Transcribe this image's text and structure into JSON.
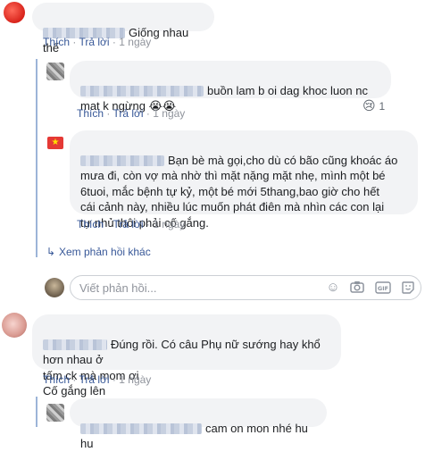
{
  "actions": {
    "like": "Thích",
    "reply": "Trả lời",
    "sep": "·",
    "time": "1 ngày"
  },
  "comments": [
    {
      "text": "Giống nhau thế"
    },
    {
      "text": "buồn lam b oi dag khoc luon nc\nmat k ngừng 😭😭",
      "reaction": "😢",
      "reaction_count": "1"
    },
    {
      "text": "Bạn bè mà gọi,cho dù có bão cũng khoác áo\nmưa đi, còn vợ mà nhờ thì mặt nặng mặt nhẹ, mình một bé\n6tuoi, mắc bệnh tự kỷ, một bé mới 5thang,bao giờ cho hết\ncái cảnh này, nhiều lúc muốn phát điên mà nhìn các con lại\ntự nhủ thôi phải cố gắng."
    },
    {
      "text": "Đúng rồi. Có câu Phụ nữ sướng hay khổ hơn nhau ở\ntấm ck mà mom ơi\nCố gắng lên"
    },
    {
      "text": "cam on mon nhé hu hu"
    }
  ],
  "more_replies": "Xem phản hồi khác",
  "reply_input": {
    "placeholder": "Viết phản hồi..."
  },
  "input_icons": [
    "smiley-icon",
    "camera-icon",
    "gif-icon",
    "sticker-icon"
  ],
  "colors": {
    "link": "#385898",
    "meta": "#90949c",
    "bubble": "#f2f3f5"
  }
}
